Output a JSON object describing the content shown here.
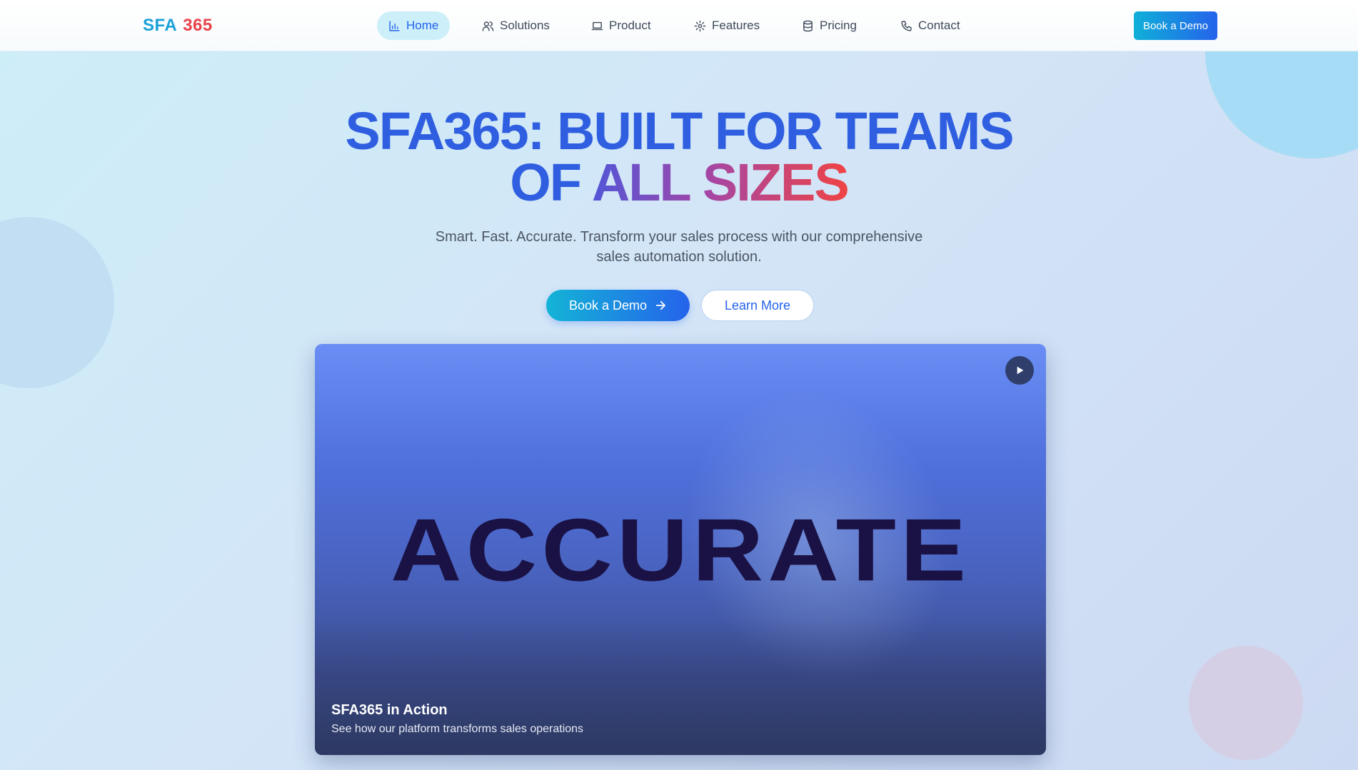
{
  "brand": {
    "part1": "SFA",
    "part2": "365"
  },
  "nav": {
    "items": [
      {
        "label": "Home",
        "icon": "bar-chart-icon",
        "active": true
      },
      {
        "label": "Solutions",
        "icon": "users-icon"
      },
      {
        "label": "Product",
        "icon": "laptop-icon"
      },
      {
        "label": "Features",
        "icon": "gear-icon"
      },
      {
        "label": "Pricing",
        "icon": "database-icon"
      },
      {
        "label": "Contact",
        "icon": "phone-icon"
      }
    ],
    "cta_label": "Book a Demo"
  },
  "hero": {
    "title_line1": "SFA365: BUILT FOR TEAMS",
    "title_line2_plain": "OF",
    "title_line2_gradient": "ALL SIZES",
    "subtitle": "Smart. Fast. Accurate. Transform your sales process with our comprehensive sales automation solution.",
    "primary_button": "Book a Demo",
    "secondary_button": "Learn More"
  },
  "video": {
    "display_word": "ACCURATE",
    "title": "SFA365 in Action",
    "description": "See how our platform transforms sales operations"
  },
  "colors": {
    "primary_blue": "#2563eb",
    "cyan": "#13b4d6",
    "logo_red": "#e8434a",
    "title_blue": "#2f5fe0"
  }
}
